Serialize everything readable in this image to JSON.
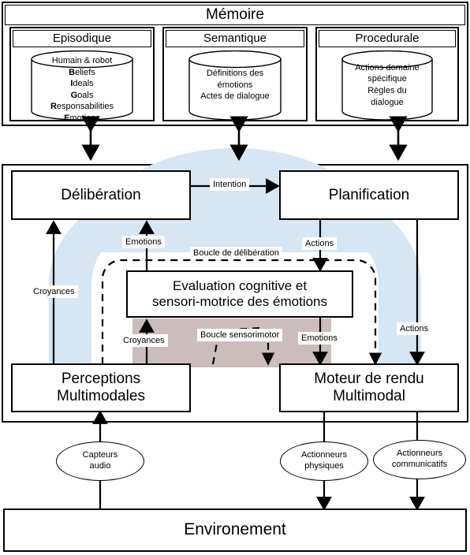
{
  "diagram": {
    "title": "Architecture cognitive et affective",
    "colors": {
      "deliberation_loop_fill": "#d6e6f2",
      "sensorimotor_loop_fill": "#cbbdbb",
      "stroke": "#000000",
      "background": "#ffffff"
    }
  },
  "memory": {
    "title": "Mémoire",
    "columns": [
      {
        "header": "Episodique",
        "cylinder_top_label": "Humain & robot",
        "lines": [
          {
            "bold": "B",
            "rest": "eliefs"
          },
          {
            "bold": "I",
            "rest": "deals"
          },
          {
            "bold": "G",
            "rest": "oals"
          },
          {
            "bold": "R",
            "rest": "esponsabilities"
          },
          {
            "bold": "E",
            "rest": "motions"
          }
        ]
      },
      {
        "header": "Semantique",
        "cylinder_top_label": "",
        "lines": [
          {
            "bold": "",
            "rest": "Définitions des"
          },
          {
            "bold": "",
            "rest": "émotions"
          },
          {
            "bold": "",
            "rest": "Actes de dialogue"
          }
        ]
      },
      {
        "header": "Procedurale",
        "cylinder_top_label": "",
        "lines": [
          {
            "bold": "",
            "rest": "Actions domaine"
          },
          {
            "bold": "",
            "rest": "spécifique"
          },
          {
            "bold": "",
            "rest": "Règles du"
          },
          {
            "bold": "",
            "rest": "dialogue"
          }
        ]
      }
    ]
  },
  "agent": {
    "deliberation": "Délibération",
    "planification": "Planification",
    "evaluation_line1": "Evaluation cognitive et",
    "evaluation_line2": "sensori-motrice des émotions",
    "perceptions_line1": "Perceptions",
    "perceptions_line2": "Multimodales",
    "rendering_line1": "Moteur de rendu",
    "rendering_line2": "Multimodal"
  },
  "edge_labels": {
    "intention": "Intention",
    "croyances_left": "Croyances",
    "emotions_up": "Emotions",
    "actions_down": "Actions",
    "boucle_deliberation": "Boucle de délibération",
    "croyances_eval": "Croyances",
    "boucle_sensorimotor": "Boucle sensorimotor",
    "emotions_down": "Emotions",
    "actions_right": "Actions"
  },
  "io": {
    "sensors": {
      "line1": "Capteurs",
      "line2": "audio"
    },
    "actuators_physical": {
      "line1": "Actionneurs",
      "line2": "physiques"
    },
    "actuators_communicative": {
      "line1": "Actionneurs",
      "line2": "communicatifs"
    }
  },
  "environment": {
    "label": "Environement"
  }
}
